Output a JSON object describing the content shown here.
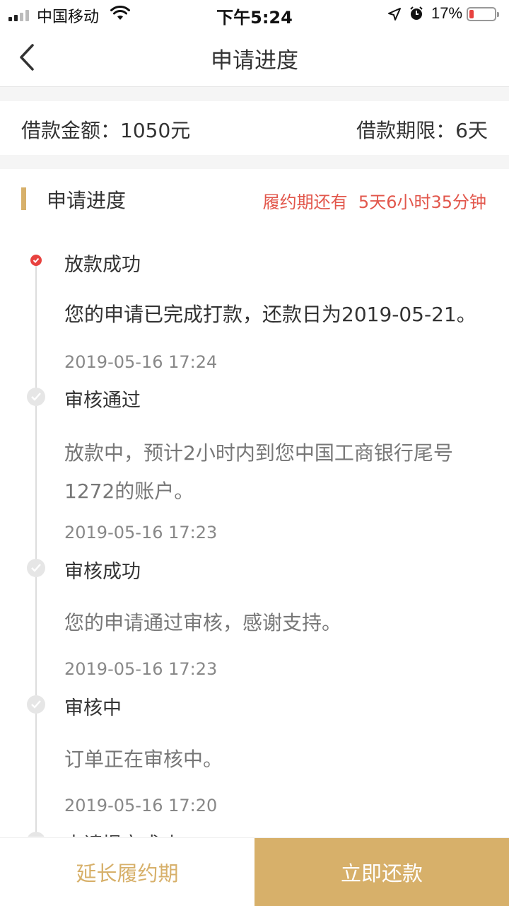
{
  "status_bar": {
    "carrier": "中国移动",
    "time": "下午5:24",
    "battery_percent": "17%",
    "battery_level": 0.17,
    "battery_color": "#e8423f"
  },
  "nav": {
    "title": "申请进度",
    "back_icon": "chevron-left-icon"
  },
  "loan_info": {
    "amount_label": "借款金额：",
    "amount_value": "1050元",
    "term_label": "借款期限：",
    "term_value": "6天"
  },
  "progress": {
    "section_title": "申请进度",
    "countdown_label": "履约期还有",
    "countdown_value": "5天6小时35分钟",
    "accent_color": "#d7b06a",
    "countdown_color": "#e2574c",
    "steps": [
      {
        "title": "放款成功",
        "desc": "您的申请已完成打款，还款日为2019-05-21。",
        "time": "2019-05-16 17:24",
        "status": "active"
      },
      {
        "title": "审核通过",
        "desc": "放款中，预计2小时内到您中国工商银行尾号1272的账户。",
        "time": "2019-05-16 17:23",
        "status": "done"
      },
      {
        "title": "审核成功",
        "desc": "您的申请通过审核，感谢支持。",
        "time": "2019-05-16 17:23",
        "status": "done"
      },
      {
        "title": "审核中",
        "desc": "订单正在审核中。",
        "time": "2019-05-16 17:20",
        "status": "done"
      },
      {
        "title": "申请提交成功",
        "status": "done"
      }
    ]
  },
  "footer": {
    "extend_label": "延长履约期",
    "repay_label": "立即还款"
  }
}
